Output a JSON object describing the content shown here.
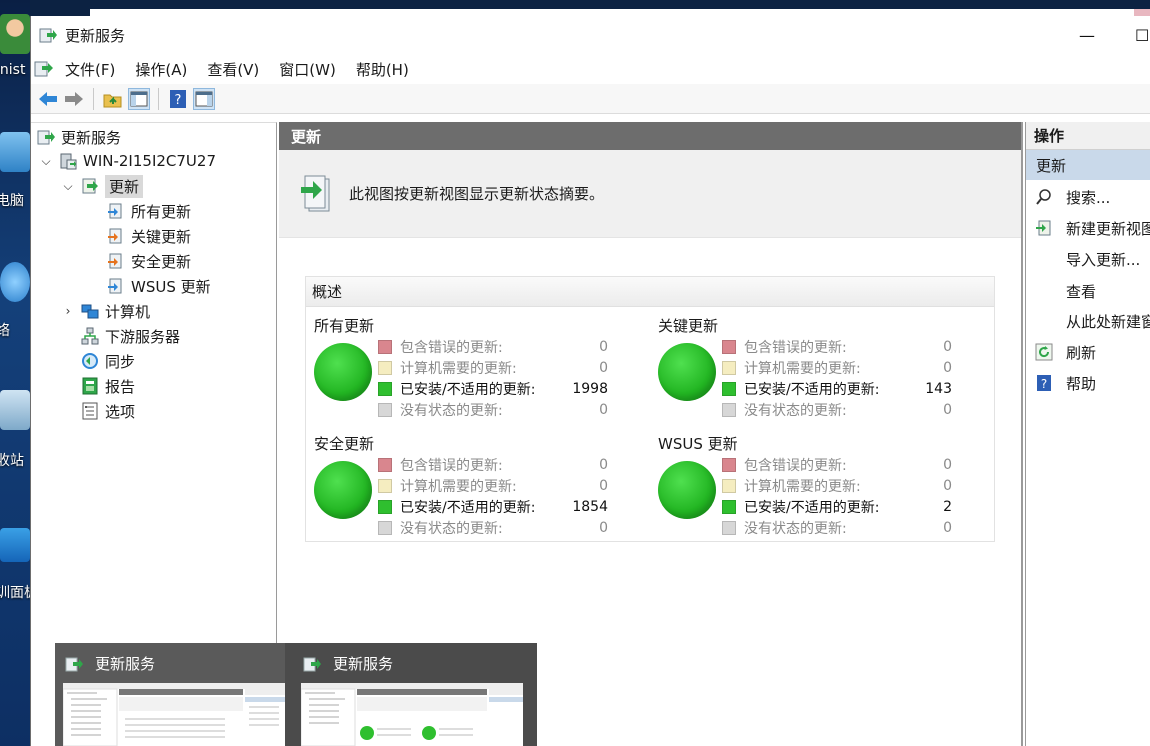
{
  "desktop": {
    "icons": [
      {
        "label": "inist",
        "icon": "user-icon"
      },
      {
        "label": "电脑",
        "icon": "computer-icon"
      },
      {
        "label": "络",
        "icon": "network-icon"
      },
      {
        "label": "收站",
        "icon": "recycle-bin-icon"
      },
      {
        "label": "训面板",
        "icon": "control-panel-icon"
      }
    ]
  },
  "window": {
    "title": "更新服务",
    "min_glyph": "—",
    "max_glyph": "☐",
    "menu": [
      "文件(F)",
      "操作(A)",
      "查看(V)",
      "窗口(W)",
      "帮助(H)"
    ]
  },
  "tree": {
    "root": "更新服务",
    "server": "WIN-2I15I2C7U27",
    "updates": "更新",
    "update_children": [
      "所有更新",
      "关键更新",
      "安全更新",
      "WSUS 更新"
    ],
    "computers": "计算机",
    "downstream": "下游服务器",
    "sync": "同步",
    "reports": "报告",
    "options": "选项"
  },
  "main": {
    "header": "更新",
    "description": "此视图按更新视图显示更新状态摘要。",
    "overview_title": "概述",
    "legend": {
      "error": "包含错误的更新:",
      "needed": "计算机需要的更新:",
      "installed": "已安装/不适用的更新:",
      "nostatus": "没有状态的更新:"
    },
    "colors": {
      "error": "#d9868e",
      "needed": "#f5edc0",
      "installed": "#2fbf2f",
      "nostatus": "#d7d7d7"
    },
    "groups": [
      {
        "title": "所有更新",
        "error": "0",
        "needed": "0",
        "installed": "1998",
        "nostatus": "0"
      },
      {
        "title": "关键更新",
        "error": "0",
        "needed": "0",
        "installed": "143",
        "nostatus": "0"
      },
      {
        "title": "安全更新",
        "error": "0",
        "needed": "0",
        "installed": "1854",
        "nostatus": "0"
      },
      {
        "title": "WSUS 更新",
        "error": "0",
        "needed": "0",
        "installed": "2",
        "nostatus": "0"
      }
    ]
  },
  "actions": {
    "title": "操作",
    "section": "更新",
    "items": [
      "搜索...",
      "新建更新视图",
      "导入更新...",
      "查看",
      "从此处新建窗",
      "刷新",
      "帮助"
    ]
  },
  "taskbar_preview": {
    "items": [
      {
        "title": "更新服务"
      },
      {
        "title": "更新服务"
      }
    ]
  }
}
